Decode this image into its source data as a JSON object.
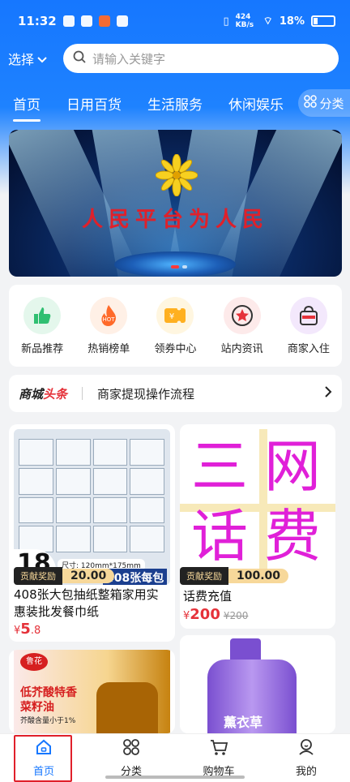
{
  "status_bar": {
    "time": "11:32",
    "net_speed": "424 KB/s",
    "battery": "18%"
  },
  "header": {
    "select_label": "选择",
    "search_placeholder": "请输入关键字",
    "tabs": [
      "首页",
      "日用百货",
      "生活服务",
      "休闲娱乐"
    ],
    "active_tab": 0,
    "category_button": "分类"
  },
  "banner": {
    "text": "人民平台为人民",
    "active_dot": 1,
    "dot_count": 2
  },
  "quick_entries": [
    {
      "label": "新品推荐",
      "icon": "thumbs-up-icon",
      "color": "#2fbf71"
    },
    {
      "label": "热销榜单",
      "icon": "hot-fire-icon",
      "color": "#ff6a2a"
    },
    {
      "label": "领券中心",
      "icon": "coupon-icon",
      "color": "#ffb020"
    },
    {
      "label": "站内资讯",
      "icon": "star-badge-icon",
      "color": "#e5323a"
    },
    {
      "label": "商家入住",
      "icon": "shopping-bag-icon",
      "color": "#a44fe0"
    }
  ],
  "headline": {
    "logo_prefix": "商城",
    "logo_suffix": "头条",
    "text": "商家提现操作流程"
  },
  "products": [
    {
      "title": "408张大包抽纸整箱家用实惠装批发餐巾纸",
      "reward_label": "贡献奖励",
      "reward_value": "20.00",
      "price_symbol": "¥",
      "price_main": "5",
      "price_dec": ".8",
      "old_price": "",
      "img_caption": "408张每包",
      "img_size": "尺寸: 120mm*175mm",
      "img_number": "18"
    },
    {
      "title": "话费充值",
      "reward_label": "贡献奖励",
      "reward_value": "100.00",
      "price_symbol": "¥",
      "price_main": "200",
      "price_dec": "",
      "old_price": "¥200",
      "img_chars": [
        "三",
        "网",
        "话",
        "费"
      ]
    },
    {
      "title": "",
      "brand": "鲁花",
      "promo1": "低芥酸特香",
      "promo2": "菜籽油",
      "promo3": "芥酸含量小于1%"
    },
    {
      "title": "",
      "label": "薰衣草"
    }
  ],
  "bottom_nav": {
    "items": [
      {
        "label": "首页",
        "icon": "home-icon"
      },
      {
        "label": "分类",
        "icon": "grid-icon"
      },
      {
        "label": "购物车",
        "icon": "cart-icon"
      },
      {
        "label": "我的",
        "icon": "user-icon"
      }
    ],
    "active": 0
  }
}
